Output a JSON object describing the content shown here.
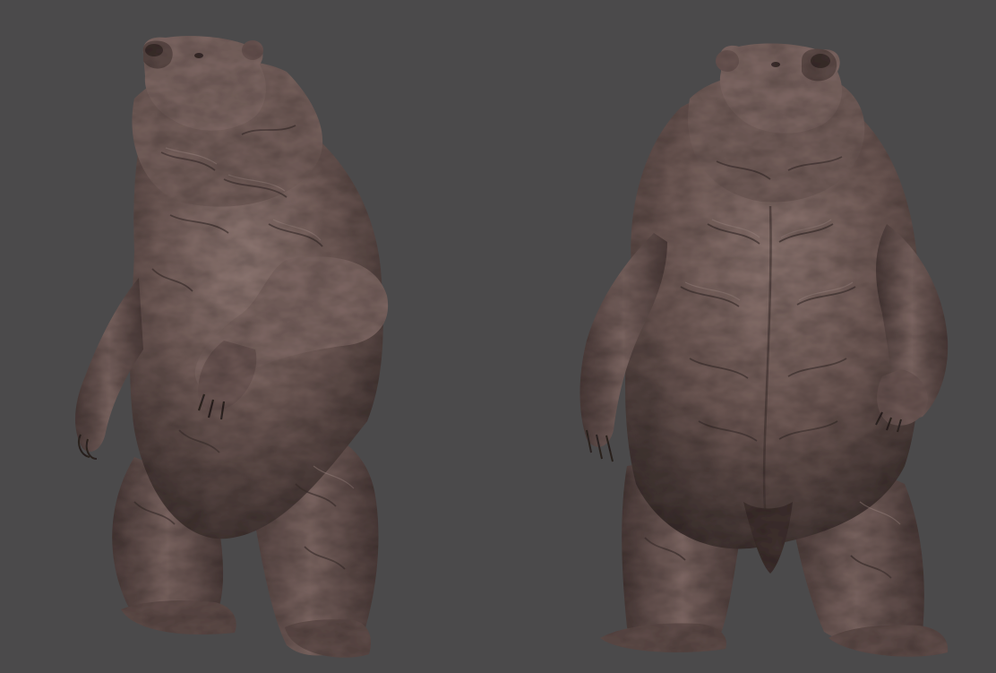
{
  "scene": {
    "background": "#4b4a4b",
    "subjects": [
      "bear-sculpt-three-quarter",
      "bear-sculpt-front"
    ],
    "palette": {
      "clay_base": "#6a5552",
      "clay_mid": "#7c6562",
      "clay_light": "#9a8580",
      "clay_shadow": "#3e302e",
      "clay_deep": "#2a2120"
    }
  }
}
